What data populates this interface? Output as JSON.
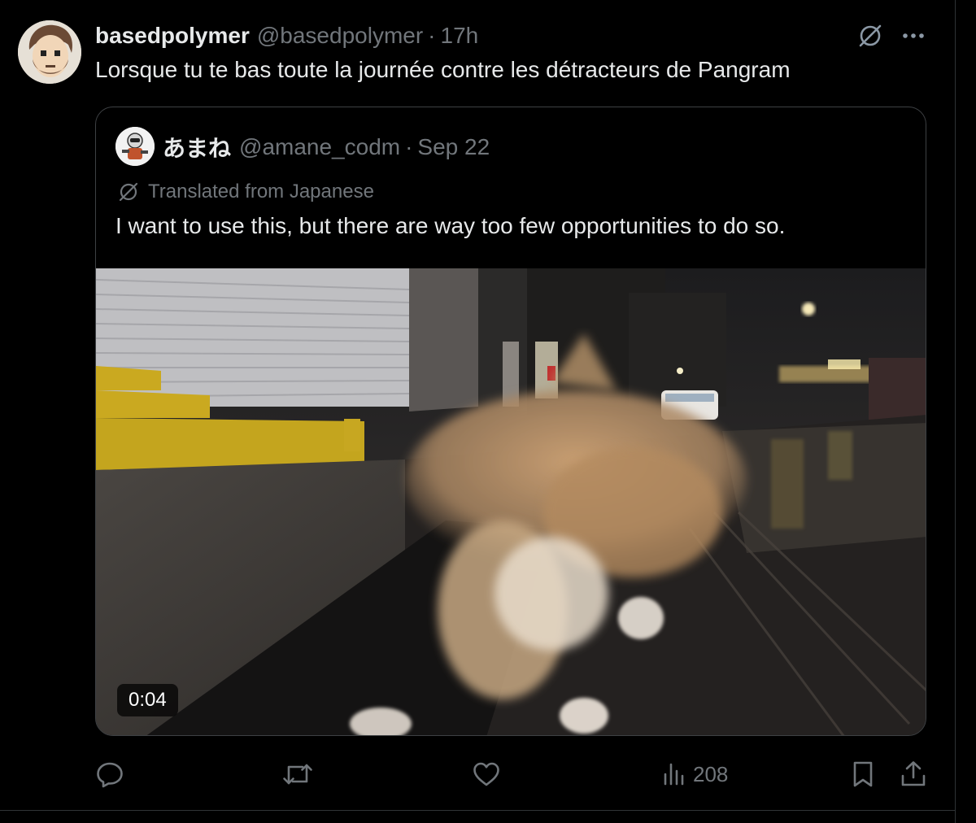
{
  "tweet": {
    "author_name": "basedpolymer",
    "author_handle": "@basedpolymer",
    "separator": "·",
    "time": "17h",
    "text": "Lorsque tu te bas toute la journée contre les détracteurs de Pangram"
  },
  "quoted_tweet": {
    "author_name": "あまね",
    "author_handle": "@amane_codm",
    "separator": "·",
    "date": "Sep 22",
    "translated_label": "Translated from Japanese",
    "text": "I want to use this, but there are way too few opportunities to do so.",
    "video_duration": "0:04"
  },
  "actions": {
    "views_count": "208"
  },
  "icons": [
    "avatar",
    "translate-icon",
    "more-icon",
    "reply-icon",
    "retweet-icon",
    "like-icon",
    "views-icon",
    "bookmark-icon",
    "share-icon"
  ],
  "colors": {
    "background": "#000000",
    "text": "#e7e9ea",
    "secondary": "#71767b",
    "border": "#2f3336"
  }
}
